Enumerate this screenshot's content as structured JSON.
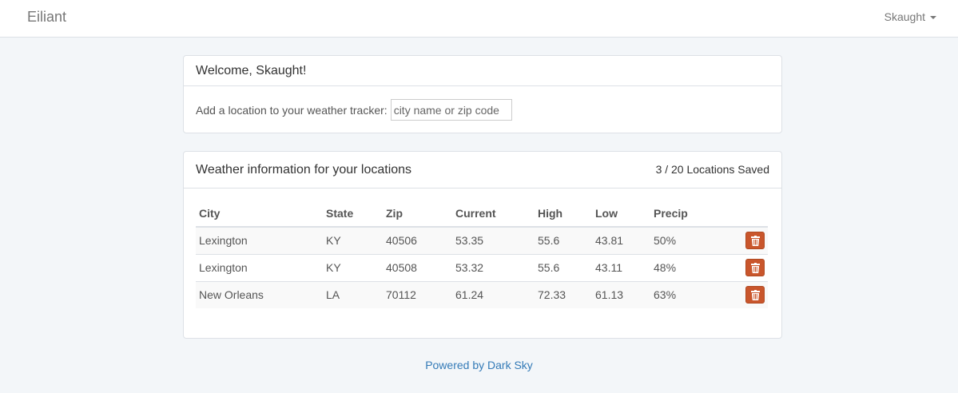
{
  "navbar": {
    "brand": "Eiliant",
    "user": "Skaught"
  },
  "welcome": {
    "title": "Welcome, Skaught!",
    "add_label": "Add a location to your weather tracker:",
    "input_placeholder": "city name or zip code",
    "input_value": ""
  },
  "weather": {
    "title": "Weather information for your locations",
    "saved_count": "3 / 20 Locations Saved",
    "columns": [
      "City",
      "State",
      "Zip",
      "Current",
      "High",
      "Low",
      "Precip"
    ],
    "rows": [
      {
        "city": "Lexington",
        "state": "KY",
        "zip": "40506",
        "current": "53.35",
        "high": "55.6",
        "low": "43.81",
        "precip": "50%"
      },
      {
        "city": "Lexington",
        "state": "KY",
        "zip": "40508",
        "current": "53.32",
        "high": "55.6",
        "low": "43.11",
        "precip": "48%"
      },
      {
        "city": "New Orleans",
        "state": "LA",
        "zip": "70112",
        "current": "61.24",
        "high": "72.33",
        "low": "61.13",
        "precip": "63%"
      }
    ],
    "delete_icon": "trash-icon"
  },
  "footer": {
    "link_text": "Powered by Dark Sky"
  },
  "colors": {
    "delete_button": "#c9562c",
    "link": "#337ab7",
    "background": "#f3f6f9"
  }
}
